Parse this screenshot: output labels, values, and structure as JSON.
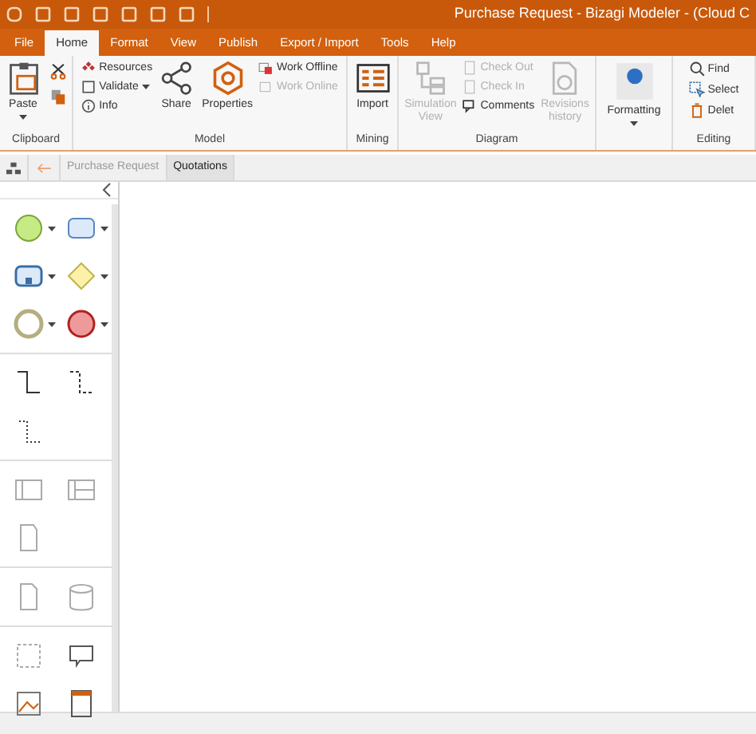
{
  "window": {
    "title": "Purchase Request - Bizagi Modeler - (Cloud C"
  },
  "menu_tabs": [
    {
      "label": "File",
      "selected": false
    },
    {
      "label": "Home",
      "selected": true
    },
    {
      "label": "Format",
      "selected": false
    },
    {
      "label": "View",
      "selected": false
    },
    {
      "label": "Publish",
      "selected": false
    },
    {
      "label": "Export / Import",
      "selected": false
    },
    {
      "label": "Tools",
      "selected": false
    },
    {
      "label": "Help",
      "selected": false
    }
  ],
  "ribbon_groups": [
    {
      "label": "Clipboard",
      "columns": [
        [
          {
            "kind": "large",
            "label": "Paste",
            "dropdown": true,
            "disabled": false
          }
        ],
        [
          {
            "kind": "icon",
            "disabled": false
          },
          {
            "kind": "icon",
            "disabled": false
          }
        ]
      ]
    },
    {
      "label": "Model",
      "columns": [
        [
          {
            "kind": "small",
            "label": "Resources",
            "dropdown": false,
            "disabled": false
          },
          {
            "kind": "small",
            "label": "Validate",
            "dropdown": true,
            "disabled": false
          },
          {
            "kind": "small",
            "label": "Info",
            "dropdown": false,
            "disabled": false
          }
        ],
        [
          {
            "kind": "large",
            "label": "Share",
            "dropdown": false,
            "disabled": false
          }
        ],
        [
          {
            "kind": "large",
            "label": "Properties",
            "dropdown": false,
            "disabled": false
          }
        ],
        [
          {
            "kind": "small",
            "label": "Work Offline",
            "dropdown": false,
            "disabled": false
          },
          {
            "kind": "small",
            "label": "Work Online",
            "dropdown": false,
            "disabled": true
          }
        ]
      ]
    },
    {
      "label": "Mining",
      "columns": [
        [
          {
            "kind": "large",
            "label": "Import",
            "dropdown": false,
            "disabled": false
          }
        ]
      ]
    },
    {
      "label": "Diagram",
      "columns": [
        [
          {
            "kind": "large",
            "label": "Simulation View",
            "dropdown": false,
            "disabled": true
          }
        ],
        [
          {
            "kind": "small",
            "label": "Check Out",
            "dropdown": false,
            "disabled": true
          },
          {
            "kind": "small",
            "label": "Check In",
            "dropdown": false,
            "disabled": true
          },
          {
            "kind": "small",
            "label": "Comments",
            "dropdown": false,
            "disabled": false
          }
        ],
        [
          {
            "kind": "large",
            "label": "Revisions history",
            "dropdown": false,
            "disabled": true
          }
        ]
      ]
    },
    {
      "columns": [
        [
          {
            "kind": "large",
            "label": "Formatting",
            "dropdown": true,
            "disabled": false
          }
        ]
      ]
    },
    {
      "label": "Editing",
      "columns": [
        [
          {
            "kind": "small",
            "label": "Find",
            "dropdown": false,
            "disabled": false
          },
          {
            "kind": "small",
            "label": "Select",
            "dropdown": false,
            "disabled": false
          },
          {
            "kind": "small",
            "label": "Delet",
            "dropdown": false,
            "disabled": false
          }
        ]
      ]
    }
  ],
  "document_tabs": [
    {
      "label": "Purchase Request",
      "selected": false
    },
    {
      "label": "Quotations",
      "selected": true
    }
  ]
}
